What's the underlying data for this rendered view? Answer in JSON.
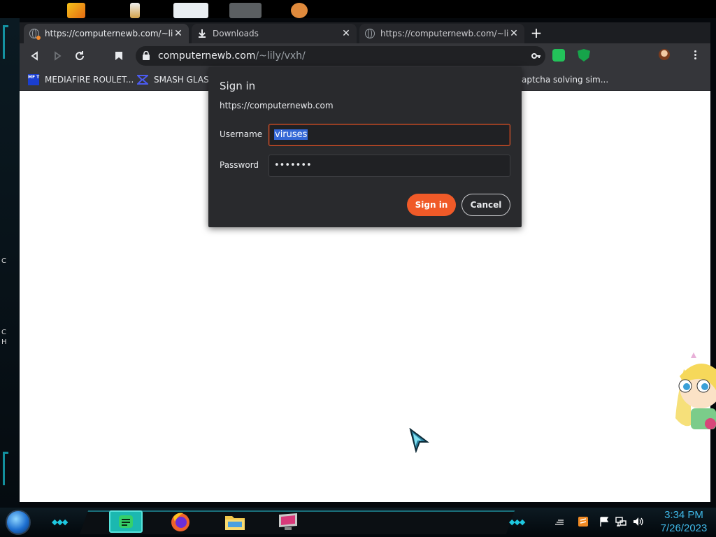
{
  "browser": {
    "tabs": [
      {
        "title": "https://computernewb.com/~lily/vxh/",
        "active": true
      },
      {
        "title": "Downloads",
        "active": false
      },
      {
        "title": "https://computernewb.com/~lily/vxh/",
        "active": false
      }
    ],
    "new_tab_label": "+",
    "url_host": "computernewb.com",
    "url_path": "/~lily/vxh/"
  },
  "bookmarks": [
    {
      "label": "MEDIAFIRE ROULET...",
      "icon": "MF T"
    },
    {
      "label": "SMASH GLASS"
    },
    {
      "label": "aptcha solving sim..."
    }
  ],
  "dialog": {
    "title": "Sign in",
    "origin": "https://computernewb.com",
    "username_label": "Username",
    "username_value": "viruses",
    "password_label": "Password",
    "password_value": "•••••••",
    "signin_label": "Sign in",
    "cancel_label": "Cancel"
  },
  "desktop": {
    "left_fragments": [
      "C",
      "C",
      "H"
    ]
  },
  "taskbar": {
    "time": "3:34 PM",
    "date": "7/26/2023"
  },
  "colors": {
    "accent": "#f05a28",
    "tab_active": "#35363a",
    "toolbar": "#35363a",
    "dialog_bg": "#292a2d",
    "focus_border": "#e0562a",
    "clock": "#3fb7e6",
    "taskbar_accent": "#1ec8e0"
  },
  "icons": {
    "tab": "globe-icon",
    "downloads_tab": "download-icon",
    "back": "back-arrow-icon",
    "forward": "forward-arrow-icon",
    "reload": "reload-icon",
    "bookmark": "bookmark-icon",
    "lock": "lock-icon",
    "key": "key-icon",
    "menu": "menu-dots-icon"
  }
}
